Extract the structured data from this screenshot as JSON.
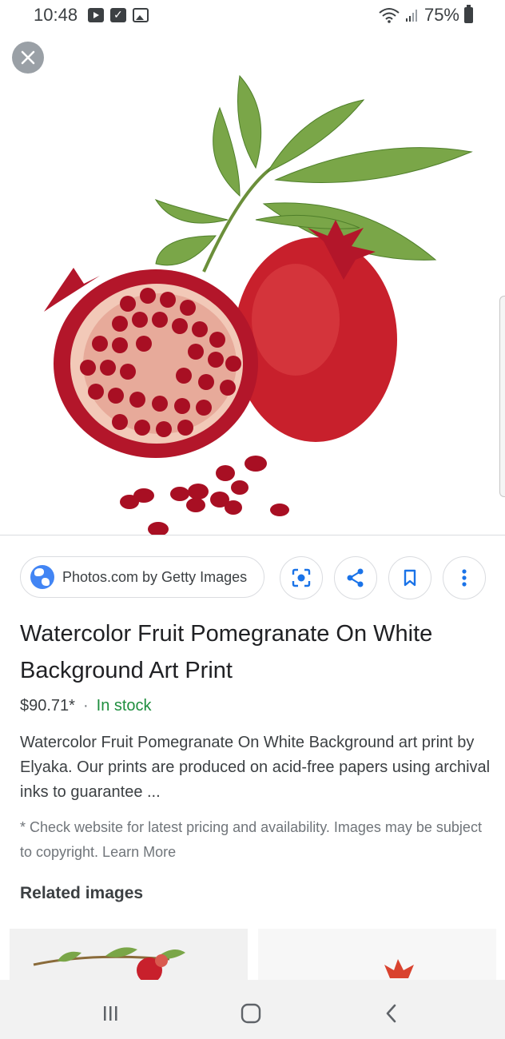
{
  "status_bar": {
    "time": "10:48",
    "battery": "75%",
    "icons": [
      "youtube-icon",
      "checkbox-icon",
      "gallery-icon",
      "wifi-icon",
      "signal-icon",
      "battery-icon"
    ]
  },
  "viewer": {
    "close_icon": "close-icon",
    "image_subject": "pomegranate"
  },
  "actions": {
    "source_label": "Photos.com by Getty Images",
    "buttons": [
      "lens-icon",
      "share-icon",
      "bookmark-icon",
      "more-icon"
    ]
  },
  "product": {
    "title": "Watercolor Fruit Pomegranate On White Background Art Print",
    "price": "$90.71*",
    "separator": "·",
    "stock": "In stock",
    "description": "Watercolor Fruit Pomegranate On White Background art print by Elyaka. Our prints are produced on acid-free papers using archival inks to guarantee ...",
    "disclaimer": "* Check website for latest pricing and availability. Images may be subject to copyright. Learn More"
  },
  "related": {
    "heading": "Related images"
  },
  "colors": {
    "accent_blue": "#1a73e8",
    "stock_green": "#1e8e3e",
    "pomegranate_red": "#b3162a",
    "leaf_green": "#6a9c3a"
  }
}
